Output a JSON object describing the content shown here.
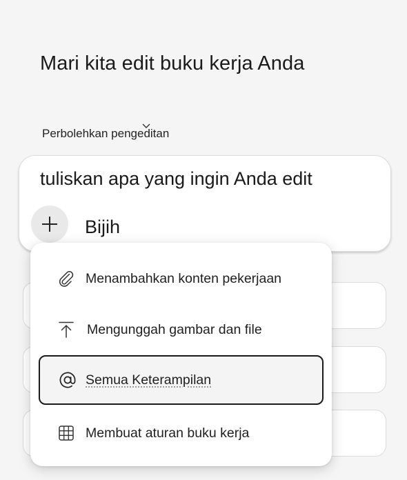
{
  "header": {
    "title": "Mari kita edit buku kerja Anda",
    "allow_label": "Perbolehkan pengeditan"
  },
  "prompt": {
    "placeholder": "tuliskan apa yang ingin Anda edit",
    "model_label": "Bijih",
    "add_icon": "plus-icon"
  },
  "menu": {
    "items": [
      {
        "label": "Menambahkan konten pekerjaan",
        "icon": "paperclip-icon"
      },
      {
        "label": "Mengunggah gambar dan file",
        "icon": "upload-icon"
      },
      {
        "label": "Semua Keterampilan",
        "icon": "at-sign-icon",
        "selected": true
      },
      {
        "label": "Membuat aturan buku kerja",
        "icon": "grid-icon"
      }
    ]
  },
  "colors": {
    "background": "#f5f5f5",
    "card": "#ffffff",
    "selected_border": "#1a1a1a"
  }
}
